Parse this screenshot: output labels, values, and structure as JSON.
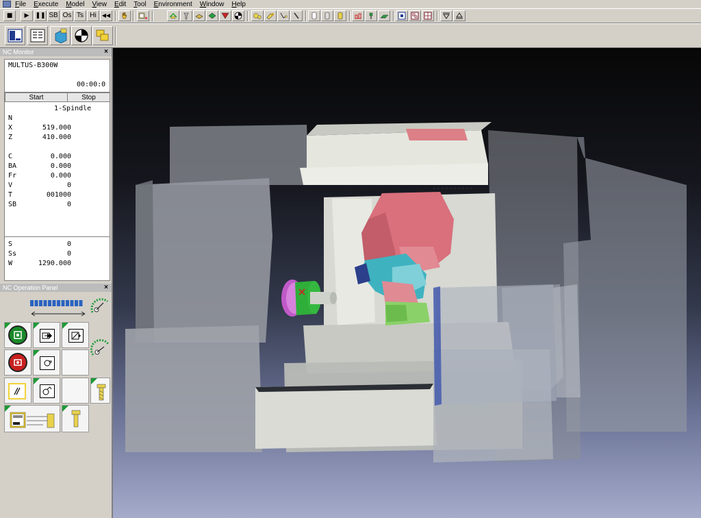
{
  "menu": [
    {
      "label": "File",
      "underline": "F",
      "rest": "ile"
    },
    {
      "label": "Execute",
      "underline": "E",
      "rest": "xecute"
    },
    {
      "label": "Model",
      "underline": "M",
      "rest": "odel"
    },
    {
      "label": "View",
      "underline": "V",
      "rest": "iew"
    },
    {
      "label": "Edit",
      "underline": "E",
      "rest": "dit"
    },
    {
      "label": "Tool",
      "underline": "T",
      "rest": "ool"
    },
    {
      "label": "Environment",
      "underline": "E",
      "rest": "nvironment"
    },
    {
      "label": "Window",
      "underline": "W",
      "rest": "indow"
    },
    {
      "label": "Help",
      "underline": "H",
      "rest": "elp"
    }
  ],
  "toolbar": {
    "stop": "■",
    "play": "▶",
    "pause": "❚❚",
    "sb": "SB",
    "os": "Os",
    "ts": "Ts",
    "hi": "Hi",
    "rewind": "◀◀"
  },
  "nc_monitor": {
    "title": "NC Monitor",
    "machine": "MULTUS-B300W",
    "time": "00:00:0",
    "start_label": "Start",
    "stop_label": "Stop",
    "spindle": "1-Spindle",
    "rows": [
      {
        "name": "N",
        "value": ""
      },
      {
        "name": "X",
        "value": "519.000"
      },
      {
        "name": "Z",
        "value": "410.000"
      },
      {
        "name": "C",
        "value": "0.000"
      },
      {
        "name": "BA",
        "value": "0.000"
      },
      {
        "name": "Fr",
        "value": "0.000"
      },
      {
        "name": "V",
        "value": "0"
      },
      {
        "name": "T",
        "value": "001000"
      },
      {
        "name": "SB",
        "value": "0"
      },
      {
        "name": "S",
        "value": "0"
      },
      {
        "name": "Ss",
        "value": "0"
      },
      {
        "name": "W",
        "value": "1290.000"
      }
    ]
  },
  "op_panel": {
    "title": "NC Operation Panel",
    "override_segments": 12,
    "override_filled": 12
  },
  "colors": {
    "green_button": "#1a8a2a",
    "red_button": "#c8201f",
    "accent_blue": "#2a62c0",
    "panel_triangle": "#1e9a36",
    "machine_pink": "#d9707c",
    "chuck_magenta": "#c05ac8",
    "chuck_green": "#2fae3a",
    "cyan_head": "#3fb2c0"
  }
}
